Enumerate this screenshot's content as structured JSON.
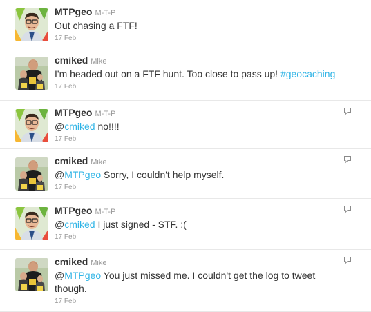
{
  "tweets": [
    {
      "user": "MTPgeo",
      "real": "M-T-P",
      "avatar": "mtp",
      "parts": [
        {
          "t": "Out chasing a FTF!"
        }
      ],
      "time": "17 Feb",
      "reply": false,
      "h": 70
    },
    {
      "user": "cmiked",
      "real": "Mike",
      "avatar": "mike",
      "parts": [
        {
          "t": "I'm headed out on a FTF hunt. Too close to pass up! "
        },
        {
          "t": "#geocaching",
          "link": true
        }
      ],
      "time": "17 Feb",
      "reply": false,
      "h": 76
    },
    {
      "user": "MTPgeo",
      "real": "M-T-P",
      "avatar": "mtp",
      "parts": [
        {
          "t": "@"
        },
        {
          "t": "cmiked",
          "link": true
        },
        {
          "t": " no!!!!"
        }
      ],
      "time": "17 Feb",
      "reply": true,
      "h": 70
    },
    {
      "user": "cmiked",
      "real": "Mike",
      "avatar": "mike",
      "parts": [
        {
          "t": "@"
        },
        {
          "t": "MTPgeo",
          "link": true
        },
        {
          "t": " Sorry, I couldn't help myself."
        }
      ],
      "time": "17 Feb",
      "reply": true,
      "h": 72
    },
    {
      "user": "MTPgeo",
      "real": "M-T-P",
      "avatar": "mtp",
      "parts": [
        {
          "t": "@"
        },
        {
          "t": "cmiked",
          "link": true
        },
        {
          "t": " I just signed - STF. :("
        }
      ],
      "time": "17 Feb",
      "reply": true,
      "h": 74
    },
    {
      "user": "cmiked",
      "real": "Mike",
      "avatar": "mike",
      "parts": [
        {
          "t": "@"
        },
        {
          "t": "MTPgeo",
          "link": true
        },
        {
          "t": " You just missed me. I couldn't get the log to tweet though."
        }
      ],
      "time": "17 Feb",
      "reply": true,
      "h": 90
    }
  ],
  "colors": {
    "link": "#2fb4e6",
    "meta": "#999999",
    "text": "#333333"
  },
  "icons": {
    "reply": "reply-bubble-icon"
  }
}
